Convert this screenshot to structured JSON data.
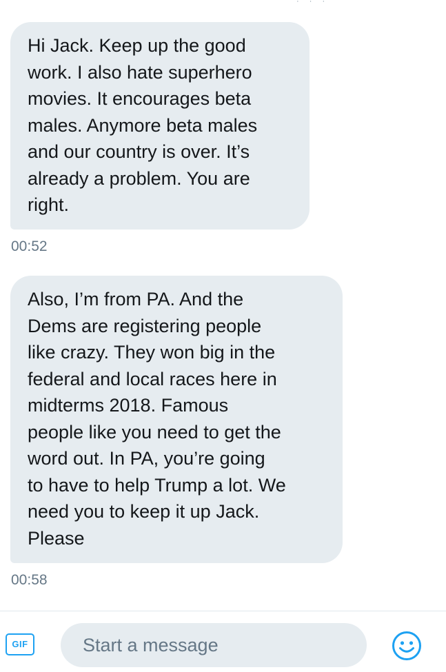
{
  "conversation": {
    "messages": [
      {
        "text": "Hi Jack. Keep up the good\nwork. I also hate superhero\nmovies. It encourages beta\nmales. Anymore beta males\nand our country is over. It’s\nalready a problem. You are\nright.",
        "time": "00:52"
      },
      {
        "text": "Also, I’m from PA. And the\nDems are registering people\nlike crazy. They won big in the\nfederal and local races here in\nmidterms 2018. Famous\npeople like you need to get the\nword out. In PA, you’re going\nto have to help Trump a lot. We\nneed you to keep it up Jack.\nPlease",
        "time": "00:58"
      }
    ]
  },
  "composer": {
    "gif_label": "GIF",
    "placeholder": "Start a message",
    "emoji_icon": "smiley-face-icon"
  },
  "colors": {
    "accent": "#1da1f2",
    "bubble_background": "#e6ecf0",
    "timestamp": "#657786",
    "text": "#14171a"
  }
}
